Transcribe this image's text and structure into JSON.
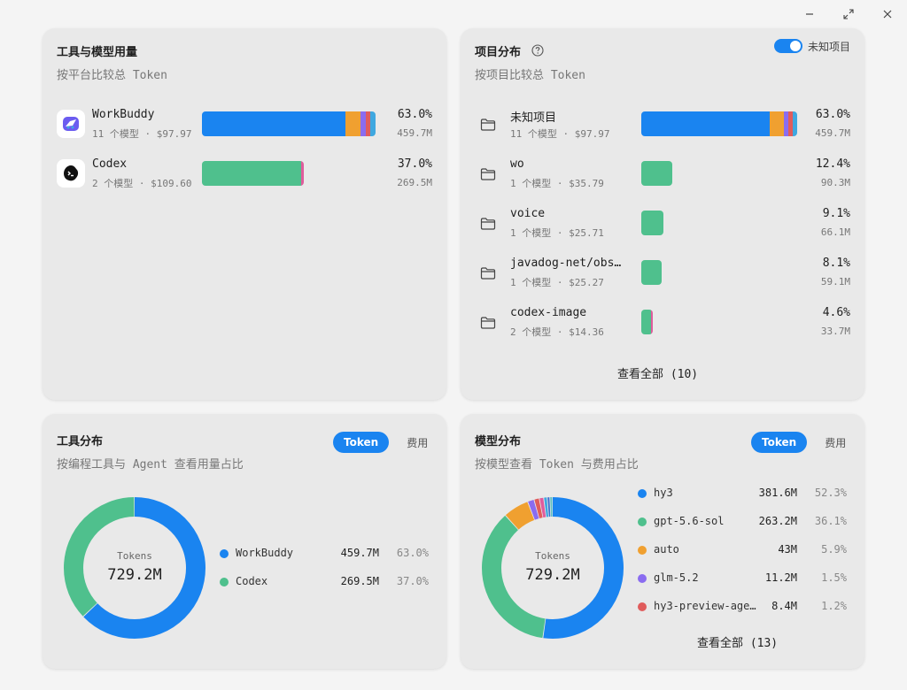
{
  "window": {
    "minimize_icon": "minimize-icon",
    "maximize_icon": "maximize-icon",
    "close_icon": "close-icon"
  },
  "tools_models": {
    "title": "工具与模型用量",
    "subtitle": "按平台比较总 Token",
    "rows": [
      {
        "name": "WorkBuddy",
        "meta": "11 个模型 · $97.97",
        "pct": "63.0%",
        "value": "459.7M",
        "share": 0.63,
        "segments": [
          {
            "color": "#1a84f0",
            "frac": 0.825
          },
          {
            "color": "#f0a030",
            "frac": 0.09
          },
          {
            "color": "#8a6cf0",
            "frac": 0.03
          },
          {
            "color": "#e05c5c",
            "frac": 0.025
          },
          {
            "color": "#3fa8e0",
            "frac": 0.03
          }
        ]
      },
      {
        "name": "Codex",
        "meta": "2 个模型 · $109.60",
        "pct": "37.0%",
        "value": "269.5M",
        "share": 0.37,
        "segments": [
          {
            "color": "#4fc08d",
            "frac": 0.97
          },
          {
            "color": "#e05c9c",
            "frac": 0.03
          }
        ]
      }
    ]
  },
  "projects": {
    "title": "项目分布",
    "help_icon": "question-circle-icon",
    "toggle_label": "未知项目",
    "subtitle": "按项目比较总 Token",
    "rows": [
      {
        "name": "未知项目",
        "meta": "11 个模型 · $97.97",
        "pct": "63.0%",
        "value": "459.7M",
        "share": 0.63,
        "segments": [
          {
            "color": "#1a84f0",
            "frac": 0.825
          },
          {
            "color": "#f0a030",
            "frac": 0.09
          },
          {
            "color": "#8a6cf0",
            "frac": 0.03
          },
          {
            "color": "#e05c5c",
            "frac": 0.025
          },
          {
            "color": "#3fa8e0",
            "frac": 0.03
          }
        ]
      },
      {
        "name": "wo",
        "meta": "1 个模型 · $35.79",
        "pct": "12.4%",
        "value": "90.3M",
        "share": 0.124,
        "segments": [
          {
            "color": "#4fc08d",
            "frac": 1
          }
        ]
      },
      {
        "name": "voice",
        "meta": "1 个模型 · $25.71",
        "pct": "9.1%",
        "value": "66.1M",
        "share": 0.091,
        "segments": [
          {
            "color": "#4fc08d",
            "frac": 1
          }
        ]
      },
      {
        "name": "javadog-net/obs…",
        "meta": "1 个模型 · $25.27",
        "pct": "8.1%",
        "value": "59.1M",
        "share": 0.081,
        "segments": [
          {
            "color": "#4fc08d",
            "frac": 1
          }
        ]
      },
      {
        "name": "codex-image",
        "meta": "2 个模型 · $14.36",
        "pct": "4.6%",
        "value": "33.7M",
        "share": 0.046,
        "segments": [
          {
            "color": "#4fc08d",
            "frac": 0.85
          },
          {
            "color": "#e05c9c",
            "frac": 0.15
          }
        ]
      }
    ],
    "view_all": "查看全部 (10)"
  },
  "tool_dist": {
    "title": "工具分布",
    "subtitle": "按编程工具与 Agent 查看用量占比",
    "tab_token": "Token",
    "tab_cost": "费用",
    "center_label": "Tokens",
    "center_value": "729.2M",
    "legend": [
      {
        "name": "WorkBuddy",
        "value": "459.7M",
        "pct": "63.0%",
        "color": "#1a84f0",
        "share": 0.63
      },
      {
        "name": "Codex",
        "value": "269.5M",
        "pct": "37.0%",
        "color": "#4fc08d",
        "share": 0.37
      }
    ]
  },
  "model_dist": {
    "title": "模型分布",
    "subtitle": "按模型查看 Token 与费用占比",
    "tab_token": "Token",
    "tab_cost": "费用",
    "center_label": "Tokens",
    "center_value": "729.2M",
    "legend": [
      {
        "name": "hy3",
        "value": "381.6M",
        "pct": "52.3%",
        "color": "#1a84f0",
        "share": 0.523
      },
      {
        "name": "gpt-5.6-sol",
        "value": "263.2M",
        "pct": "36.1%",
        "color": "#4fc08d",
        "share": 0.361
      },
      {
        "name": "auto",
        "value": "43M",
        "pct": "5.9%",
        "color": "#f0a030",
        "share": 0.059
      },
      {
        "name": "glm-5.2",
        "value": "11.2M",
        "pct": "1.5%",
        "color": "#8a6cf0",
        "share": 0.015
      },
      {
        "name": "hy3-preview-age…",
        "value": "8.4M",
        "pct": "1.2%",
        "color": "#e05c5c",
        "share": 0.012
      }
    ],
    "extra_slices": [
      {
        "color": "#e05c9c",
        "share": 0.01
      },
      {
        "color": "#3fa8e0",
        "share": 0.008
      },
      {
        "color": "#3a6fd0",
        "share": 0.006
      },
      {
        "color": "#5cc0c0",
        "share": 0.006
      }
    ],
    "view_all": "查看全部 (13)"
  }
}
